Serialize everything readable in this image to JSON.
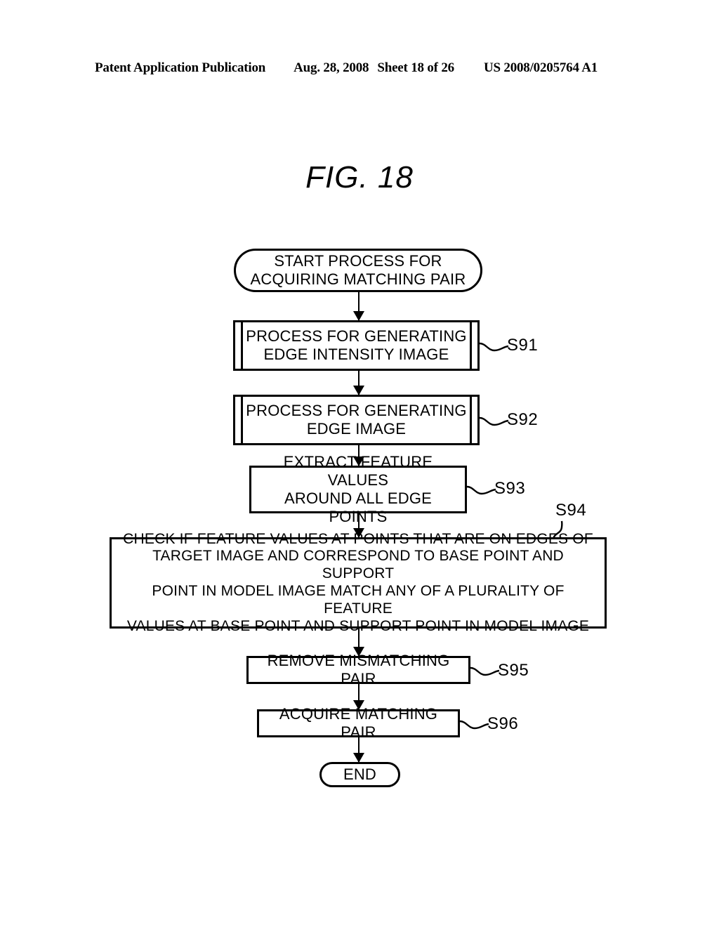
{
  "header": {
    "publication": "Patent Application Publication",
    "date": "Aug. 28, 2008",
    "sheet": "Sheet 18 of 26",
    "patent_number": "US 2008/0205764 A1"
  },
  "figure": {
    "title": "FIG. 18"
  },
  "flowchart": {
    "nodes": {
      "start": {
        "shape": "terminator",
        "line1": "START PROCESS FOR",
        "line2": "ACQUIRING MATCHING PAIR"
      },
      "s91": {
        "shape": "subroutine",
        "line1": "PROCESS FOR GENERATING",
        "line2": "EDGE INTENSITY IMAGE",
        "step": "S91"
      },
      "s92": {
        "shape": "subroutine",
        "line1": "PROCESS FOR GENERATING",
        "line2": "EDGE IMAGE",
        "step": "S92"
      },
      "s93": {
        "shape": "process",
        "line1": "EXTRACT FEATURE VALUES",
        "line2": "AROUND ALL EDGE POINTS",
        "step": "S93"
      },
      "s94": {
        "shape": "process",
        "line1": "CHECK IF FEATURE VALUES AT POINTS THAT ARE ON EDGES OF",
        "line2": "TARGET IMAGE AND CORRESPOND TO BASE POINT AND SUPPORT",
        "line3": "POINT IN MODEL IMAGE MATCH ANY OF A PLURALITY OF FEATURE",
        "line4": "VALUES AT BASE POINT AND SUPPORT POINT IN MODEL IMAGE",
        "step": "S94"
      },
      "s95": {
        "shape": "process",
        "line1": "REMOVE MISMATCHING PAIR",
        "step": "S95"
      },
      "s96": {
        "shape": "process",
        "line1": "ACQUIRE MATCHING PAIR",
        "step": "S96"
      },
      "end": {
        "shape": "terminator",
        "line1": "END"
      }
    }
  },
  "colors": {
    "ink": "#000000",
    "paper": "#ffffff"
  }
}
